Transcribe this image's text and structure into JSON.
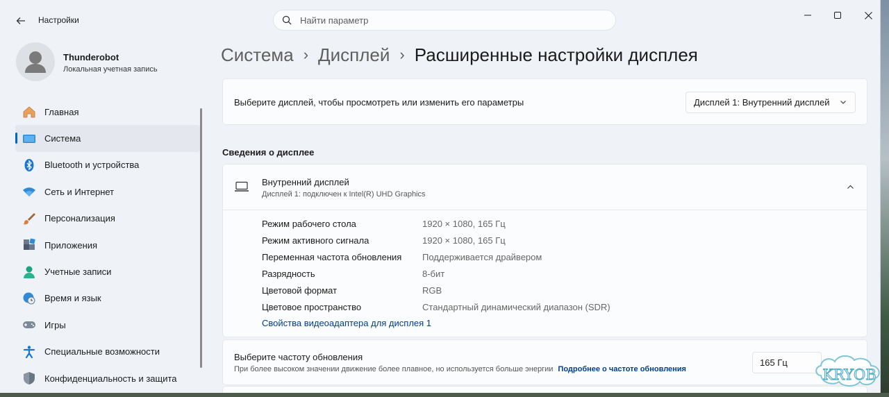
{
  "window": {
    "app_title": "Настройки",
    "search_placeholder": "Найти параметр"
  },
  "profile": {
    "name": "Thunderobot",
    "account_type": "Локальная учетная запись"
  },
  "sidebar": {
    "items": [
      {
        "label": "Главная",
        "icon": "home-icon"
      },
      {
        "label": "Система",
        "icon": "system-icon",
        "active": true
      },
      {
        "label": "Bluetooth и устройства",
        "icon": "bluetooth-icon"
      },
      {
        "label": "Сеть и Интернет",
        "icon": "wifi-icon"
      },
      {
        "label": "Персонализация",
        "icon": "brush-icon"
      },
      {
        "label": "Приложения",
        "icon": "apps-icon"
      },
      {
        "label": "Учетные записи",
        "icon": "accounts-icon"
      },
      {
        "label": "Время и язык",
        "icon": "time-language-icon"
      },
      {
        "label": "Игры",
        "icon": "gamepad-icon"
      },
      {
        "label": "Специальные возможности",
        "icon": "accessibility-icon"
      },
      {
        "label": "Конфиденциальность и защита",
        "icon": "shield-icon"
      }
    ]
  },
  "breadcrumb": {
    "level1": "Система",
    "level2": "Дисплей",
    "current": "Расширенные настройки дисплея"
  },
  "display_select": {
    "label": "Выберите дисплей, чтобы просмотреть или изменить его параметры",
    "value": "Дисплей 1: Внутренний дисплей"
  },
  "display_info": {
    "section_title": "Сведения о дисплее",
    "title": "Внутренний дисплей",
    "subtitle": "Дисплей 1: подключен к Intel(R) UHD Graphics",
    "rows": [
      {
        "key": "Режим рабочего стола",
        "value": "1920 × 1080, 165 Гц"
      },
      {
        "key": "Режим активного сигнала",
        "value": "1920 × 1080, 165 Гц"
      },
      {
        "key": "Переменная частота обновления",
        "value": "Поддерживается драйвером"
      },
      {
        "key": "Разрядность",
        "value": "8-бит"
      },
      {
        "key": "Цветовой формат",
        "value": "RGB"
      },
      {
        "key": "Цветовое пространство",
        "value": "Стандартный динамический диапазон (SDR)"
      }
    ],
    "adapter_link": "Свойства видеоадаптера для дисплея 1"
  },
  "refresh_rate": {
    "title": "Выберите частоту обновления",
    "description": "При более высоком значении движение более плавное, но используется больше энергии",
    "link": "Подробнее о частоте обновления",
    "value": "165 Гц"
  },
  "watermark": {
    "text": "KRYOB"
  },
  "colors": {
    "accent": "#0067c0",
    "link": "#003e92",
    "window_bg": "#eff3f8",
    "card_bg": "#fbfcfd"
  }
}
